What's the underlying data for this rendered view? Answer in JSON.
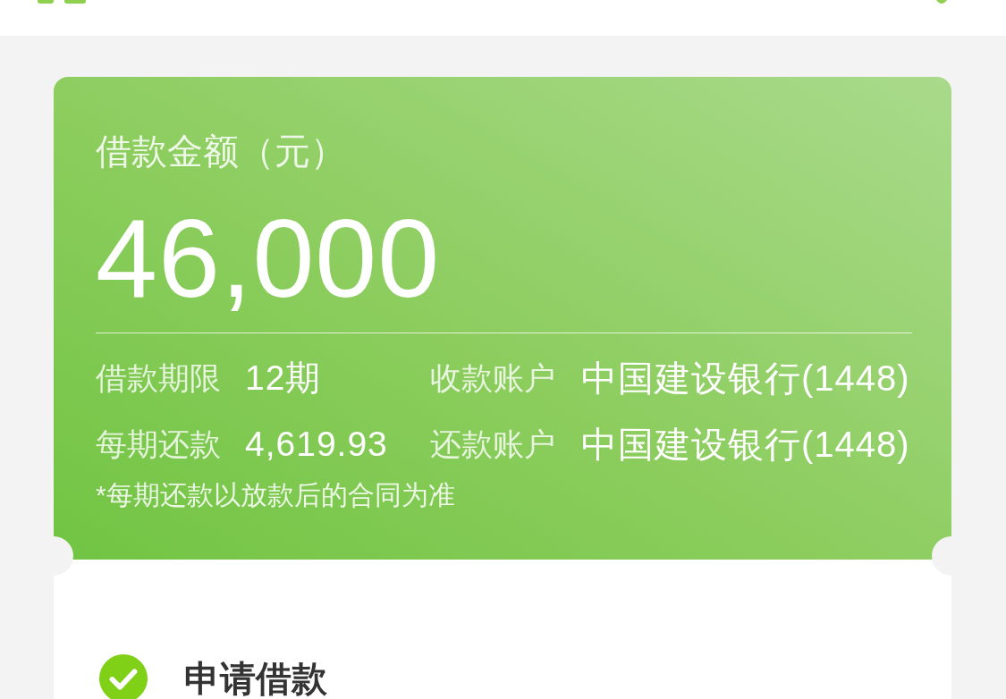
{
  "loan_card": {
    "amount_label": "借款金额（元）",
    "amount": "46,000",
    "details": [
      {
        "label": "借款期限",
        "value": "12期"
      },
      {
        "label": "收款账户",
        "value": "中国建设银行(1448)"
      },
      {
        "label": "每期还款",
        "value": "4,619.93"
      },
      {
        "label": "还款账户",
        "value": "中国建设银行(1448)"
      }
    ],
    "note": "*每期还款以放款后的合同为准"
  },
  "progress_steps": [
    {
      "title": "申请借款",
      "done": true
    }
  ]
}
